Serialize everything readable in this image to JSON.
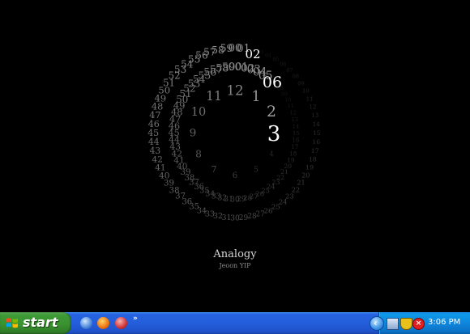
{
  "screensaver": {
    "title": "Analogy",
    "author": "Jeoon YIP",
    "clock": {
      "hour_display": "3",
      "minute_display": "06",
      "second_display": "02",
      "hour_numbers": [
        "1",
        "2",
        "3",
        "4",
        "5",
        "6",
        "7",
        "8",
        "9",
        "10",
        "11",
        "12"
      ],
      "minute_ring_highlight": "06",
      "second_ring_highlight": "02"
    }
  },
  "taskbar": {
    "start_label": "start",
    "quick_launch": [
      {
        "name": "internet-explorer-icon"
      },
      {
        "name": "firefox-icon"
      },
      {
        "name": "app-icon"
      }
    ],
    "more_label": "»",
    "tray_expand_label": "‹",
    "clock_time": "3:06 PM"
  },
  "colors": {
    "background": "#000000",
    "taskbar_blue": "#245edb",
    "start_green": "#3a9231",
    "tray_blue": "#0f86dc"
  }
}
